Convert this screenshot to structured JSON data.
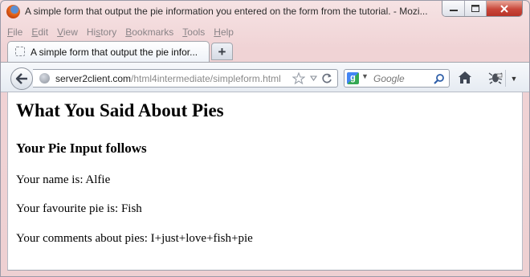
{
  "window": {
    "title": "A simple form that output the pie information you entered on the form from the tutorial. - Mozi...",
    "controls": [
      "minimize",
      "maximize",
      "close"
    ]
  },
  "menubar": {
    "items": [
      {
        "label": "File"
      },
      {
        "label": "Edit"
      },
      {
        "label": "View"
      },
      {
        "label": "History"
      },
      {
        "label": "Bookmarks"
      },
      {
        "label": "Tools"
      },
      {
        "label": "Help"
      }
    ]
  },
  "tabs": [
    {
      "title": "A simple form that output the pie infor...",
      "active": true
    }
  ],
  "new_tab_label": "+",
  "navbar": {
    "url_host": "server2client.com",
    "url_path": "/html4intermediate/simpleform.html",
    "search_placeholder": "Google",
    "search_engine_icon": "google-icon"
  },
  "page": {
    "heading": "What You Said About Pies",
    "subheading": "Your Pie Input follows",
    "lines": [
      "Your name is: Alfie",
      "Your favourite pie is: Fish",
      "Your comments about pies: I+just+love+fish+pie"
    ]
  },
  "colors": {
    "chrome_bg": "#f3d9da",
    "close_button": "#c9473a",
    "url_text": "#222222",
    "page_bg": "#ffffff"
  }
}
